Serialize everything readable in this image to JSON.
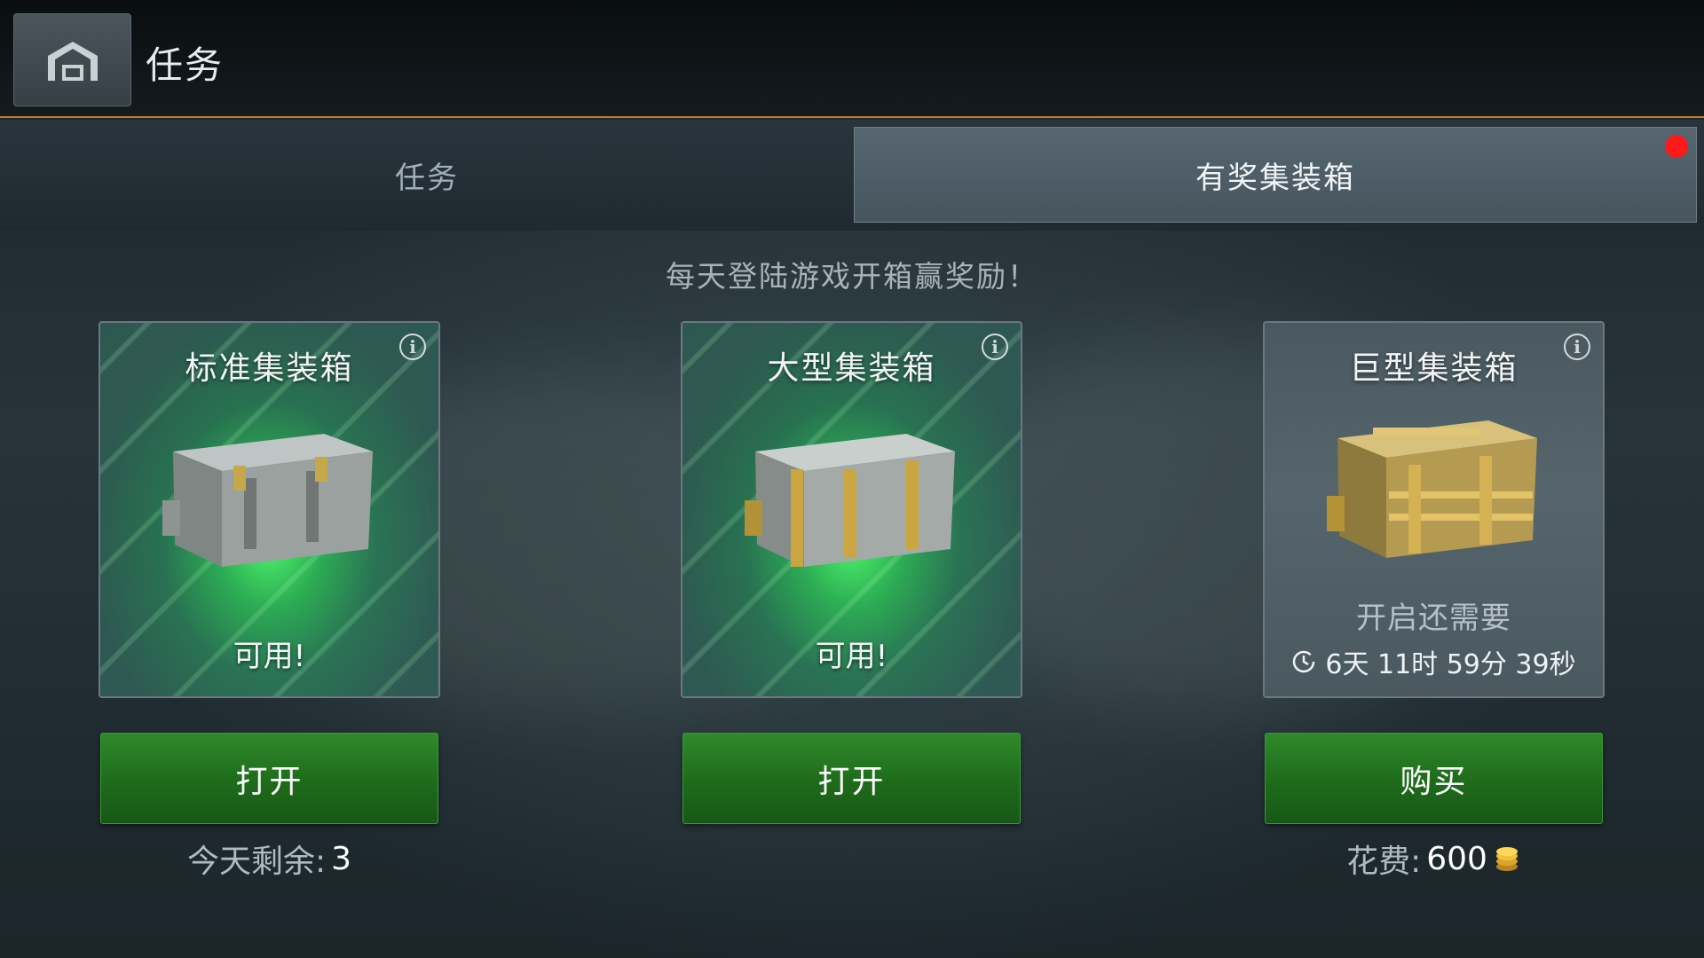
{
  "header": {
    "title": "任务"
  },
  "tabs": [
    {
      "label": "任务",
      "active": false
    },
    {
      "label": "有奖集装箱",
      "active": true
    }
  ],
  "subtitle": "每天登陆游戏开箱赢奖励！",
  "cards": [
    {
      "title": "标准集装箱",
      "status": "可用!",
      "button": "打开",
      "footer_label": "今天剩余:",
      "footer_value": "3"
    },
    {
      "title": "大型集装箱",
      "status": "可用!",
      "button": "打开"
    },
    {
      "title": "巨型集装箱",
      "status_line1": "开启还需要",
      "timer": "6天 11时 59分 39秒",
      "button": "购买",
      "footer_label": "花费:",
      "footer_value": "600"
    }
  ],
  "icons": {
    "home": "home-icon",
    "info": "info-icon",
    "timer": "clock-icon",
    "currency": "gold-coins-icon"
  },
  "colors": {
    "accent_line": "#c87a2c",
    "button_green": "#1e6b1b",
    "notification": "#ff1a1a",
    "glow_green": "#50ff6e"
  }
}
